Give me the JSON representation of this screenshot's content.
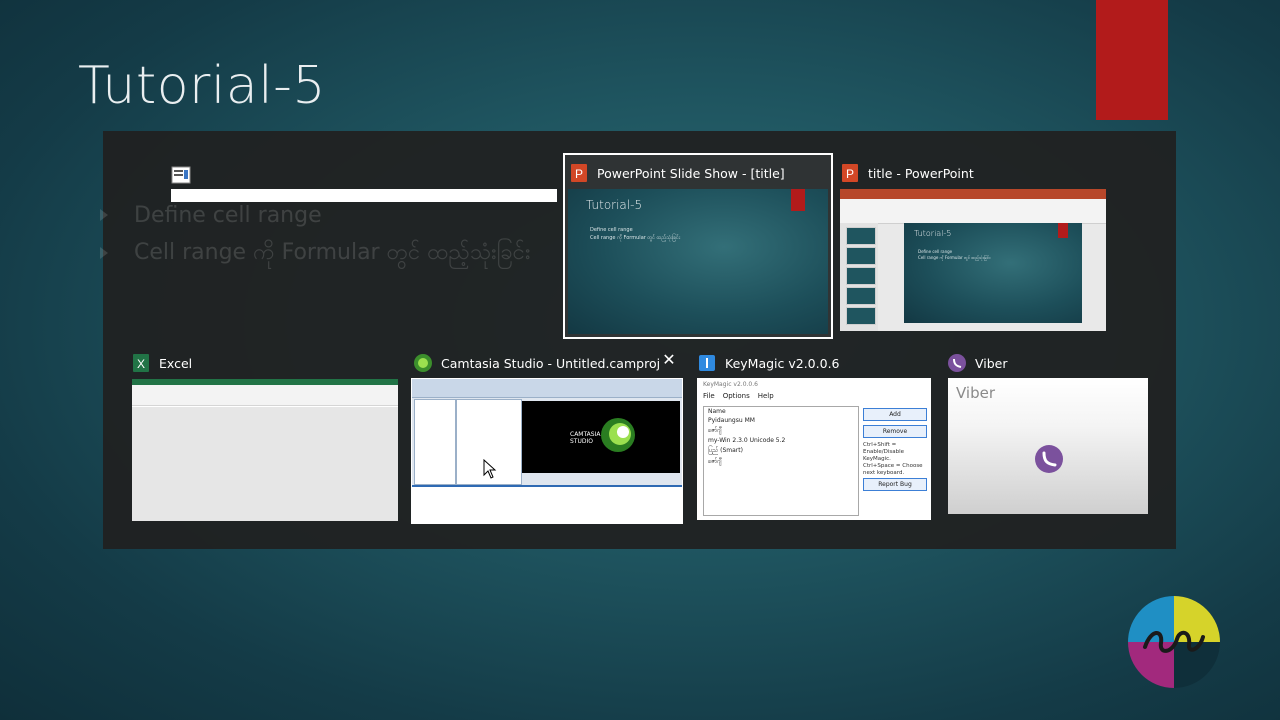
{
  "slide": {
    "title": "Tutorial-5",
    "bullets": [
      "Define cell range",
      "Cell range ကို Formular တွင် ထည့်သုံးခြင်း"
    ]
  },
  "switcher": {
    "windows": [
      {
        "title": ""
      },
      {
        "title": "PowerPoint Slide Show - [title]",
        "selected": true
      },
      {
        "title": "title - PowerPoint"
      },
      {
        "title": "Excel"
      },
      {
        "title": "Camtasia Studio - Untitled.camproj"
      },
      {
        "title": "KeyMagic v2.0.0.6"
      },
      {
        "title": "Viber"
      }
    ],
    "close_label": "✕"
  },
  "thumb_ppt": {
    "title": "Tutorial-5",
    "bullets": [
      "Define cell range",
      "Cell range ကို Formular တွင် ထည့်သုံးခြင်း"
    ]
  },
  "thumb_ppt_editor": {
    "title": "Tutorial-5",
    "bullets": [
      "Define cell range",
      "Cell range ကို Formular တွင် ထည့်သုံးခြင်း"
    ]
  },
  "thumb_camtasia": {
    "logo_text": "CAMTASIA STUDIO"
  },
  "thumb_keymagic": {
    "title": "KeyMagic v2.0.0.6",
    "menu": [
      "File",
      "Options",
      "Help"
    ],
    "list_header": "Name",
    "list_items": [
      "Pyidaungsu MM",
      "ဇော်ဂျီ",
      "my-Win 2.3.0 Unicode 5.2",
      "ပြည် (Smart)",
      "ဇော်ဂျီ"
    ],
    "buttons": [
      "Add",
      "Remove",
      "Report Bug"
    ],
    "note1": "Ctrl+Shift = Enable/Disable KeyMagic.",
    "note2": "Ctrl+Space = Choose next keyboard."
  },
  "thumb_viber": {
    "title": "Viber"
  },
  "colors": {
    "accent_red": "#b21b1b",
    "excel_green": "#217346",
    "ppt_orange": "#b7472a",
    "viber_purple": "#7b519d"
  }
}
